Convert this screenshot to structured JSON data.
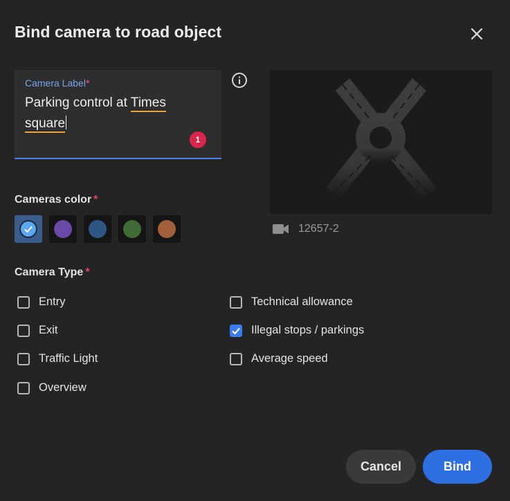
{
  "dialog": {
    "title": "Bind camera to road object"
  },
  "camera_label": {
    "label": "Camera Label",
    "required_mark": "*",
    "value_line1": "Parking control at ",
    "value_word1": "Times",
    "value_word2": "square",
    "error_count": "1"
  },
  "preview": {
    "camera_id": "12657-2",
    "icon": "video-camera-icon"
  },
  "cameras_color": {
    "label": "Cameras color",
    "required_mark": "*",
    "selected_index": 0,
    "options": [
      "#5ba8f0",
      "#6a4aa6",
      "#2f5683",
      "#3f6b35",
      "#a15f3a"
    ]
  },
  "camera_type": {
    "label": "Camera Type",
    "required_mark": "*",
    "left": [
      {
        "label": "Entry",
        "checked": false
      },
      {
        "label": "Exit",
        "checked": false
      },
      {
        "label": "Traffic Light",
        "checked": false
      },
      {
        "label": "Overview",
        "checked": false
      }
    ],
    "right": [
      {
        "label": "Technical allowance",
        "checked": false
      },
      {
        "label": "Illegal stops / parkings",
        "checked": true
      },
      {
        "label": "Average speed",
        "checked": false
      }
    ]
  },
  "actions": {
    "cancel_label": "Cancel",
    "bind_label": "Bind"
  }
}
